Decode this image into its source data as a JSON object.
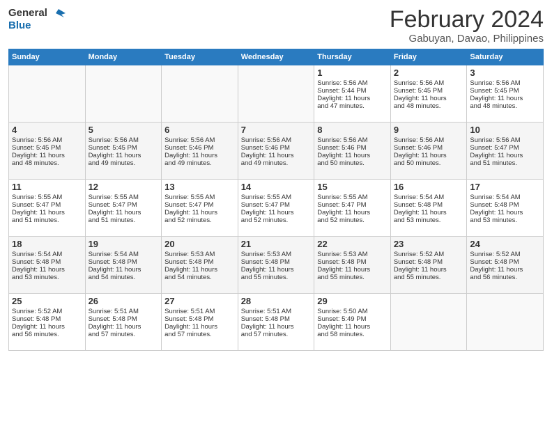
{
  "header": {
    "logo_line1": "General",
    "logo_line2": "Blue",
    "title": "February 2024",
    "subtitle": "Gabuyan, Davao, Philippines"
  },
  "weekdays": [
    "Sunday",
    "Monday",
    "Tuesday",
    "Wednesday",
    "Thursday",
    "Friday",
    "Saturday"
  ],
  "weeks": [
    [
      {
        "day": "",
        "info": ""
      },
      {
        "day": "",
        "info": ""
      },
      {
        "day": "",
        "info": ""
      },
      {
        "day": "",
        "info": ""
      },
      {
        "day": "1",
        "info": "Sunrise: 5:56 AM\nSunset: 5:44 PM\nDaylight: 11 hours\nand 47 minutes."
      },
      {
        "day": "2",
        "info": "Sunrise: 5:56 AM\nSunset: 5:45 PM\nDaylight: 11 hours\nand 48 minutes."
      },
      {
        "day": "3",
        "info": "Sunrise: 5:56 AM\nSunset: 5:45 PM\nDaylight: 11 hours\nand 48 minutes."
      }
    ],
    [
      {
        "day": "4",
        "info": "Sunrise: 5:56 AM\nSunset: 5:45 PM\nDaylight: 11 hours\nand 48 minutes."
      },
      {
        "day": "5",
        "info": "Sunrise: 5:56 AM\nSunset: 5:45 PM\nDaylight: 11 hours\nand 49 minutes."
      },
      {
        "day": "6",
        "info": "Sunrise: 5:56 AM\nSunset: 5:46 PM\nDaylight: 11 hours\nand 49 minutes."
      },
      {
        "day": "7",
        "info": "Sunrise: 5:56 AM\nSunset: 5:46 PM\nDaylight: 11 hours\nand 49 minutes."
      },
      {
        "day": "8",
        "info": "Sunrise: 5:56 AM\nSunset: 5:46 PM\nDaylight: 11 hours\nand 50 minutes."
      },
      {
        "day": "9",
        "info": "Sunrise: 5:56 AM\nSunset: 5:46 PM\nDaylight: 11 hours\nand 50 minutes."
      },
      {
        "day": "10",
        "info": "Sunrise: 5:56 AM\nSunset: 5:47 PM\nDaylight: 11 hours\nand 51 minutes."
      }
    ],
    [
      {
        "day": "11",
        "info": "Sunrise: 5:55 AM\nSunset: 5:47 PM\nDaylight: 11 hours\nand 51 minutes."
      },
      {
        "day": "12",
        "info": "Sunrise: 5:55 AM\nSunset: 5:47 PM\nDaylight: 11 hours\nand 51 minutes."
      },
      {
        "day": "13",
        "info": "Sunrise: 5:55 AM\nSunset: 5:47 PM\nDaylight: 11 hours\nand 52 minutes."
      },
      {
        "day": "14",
        "info": "Sunrise: 5:55 AM\nSunset: 5:47 PM\nDaylight: 11 hours\nand 52 minutes."
      },
      {
        "day": "15",
        "info": "Sunrise: 5:55 AM\nSunset: 5:47 PM\nDaylight: 11 hours\nand 52 minutes."
      },
      {
        "day": "16",
        "info": "Sunrise: 5:54 AM\nSunset: 5:48 PM\nDaylight: 11 hours\nand 53 minutes."
      },
      {
        "day": "17",
        "info": "Sunrise: 5:54 AM\nSunset: 5:48 PM\nDaylight: 11 hours\nand 53 minutes."
      }
    ],
    [
      {
        "day": "18",
        "info": "Sunrise: 5:54 AM\nSunset: 5:48 PM\nDaylight: 11 hours\nand 53 minutes."
      },
      {
        "day": "19",
        "info": "Sunrise: 5:54 AM\nSunset: 5:48 PM\nDaylight: 11 hours\nand 54 minutes."
      },
      {
        "day": "20",
        "info": "Sunrise: 5:53 AM\nSunset: 5:48 PM\nDaylight: 11 hours\nand 54 minutes."
      },
      {
        "day": "21",
        "info": "Sunrise: 5:53 AM\nSunset: 5:48 PM\nDaylight: 11 hours\nand 55 minutes."
      },
      {
        "day": "22",
        "info": "Sunrise: 5:53 AM\nSunset: 5:48 PM\nDaylight: 11 hours\nand 55 minutes."
      },
      {
        "day": "23",
        "info": "Sunrise: 5:52 AM\nSunset: 5:48 PM\nDaylight: 11 hours\nand 55 minutes."
      },
      {
        "day": "24",
        "info": "Sunrise: 5:52 AM\nSunset: 5:48 PM\nDaylight: 11 hours\nand 56 minutes."
      }
    ],
    [
      {
        "day": "25",
        "info": "Sunrise: 5:52 AM\nSunset: 5:48 PM\nDaylight: 11 hours\nand 56 minutes."
      },
      {
        "day": "26",
        "info": "Sunrise: 5:51 AM\nSunset: 5:48 PM\nDaylight: 11 hours\nand 57 minutes."
      },
      {
        "day": "27",
        "info": "Sunrise: 5:51 AM\nSunset: 5:48 PM\nDaylight: 11 hours\nand 57 minutes."
      },
      {
        "day": "28",
        "info": "Sunrise: 5:51 AM\nSunset: 5:48 PM\nDaylight: 11 hours\nand 57 minutes."
      },
      {
        "day": "29",
        "info": "Sunrise: 5:50 AM\nSunset: 5:49 PM\nDaylight: 11 hours\nand 58 minutes."
      },
      {
        "day": "",
        "info": ""
      },
      {
        "day": "",
        "info": ""
      }
    ]
  ]
}
